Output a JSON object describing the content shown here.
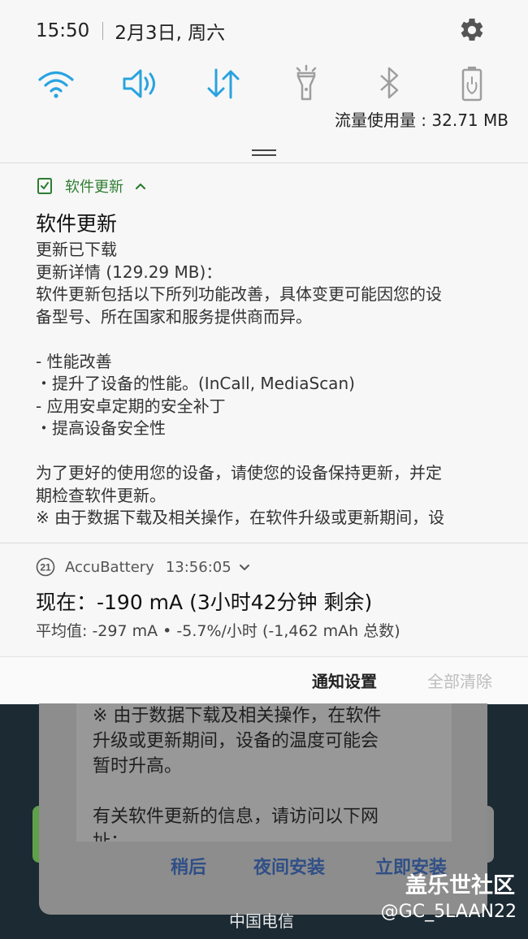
{
  "status_bar": {
    "time": "15:50",
    "date": "2月3日, 周六"
  },
  "quick_settings": {
    "icons": [
      "wifi-icon",
      "sound-icon",
      "mobile-data-icon",
      "flashlight-icon",
      "bluetooth-icon",
      "battery-saver-icon"
    ],
    "active_color": "#29a3e0",
    "inactive_color": "#9e9e9e"
  },
  "data_usage": "流量使用量 : 32.71 MB",
  "notifications": {
    "update": {
      "app_name": "软件更新",
      "title": "软件更新",
      "body": [
        "更新已下载",
        "更新详情 (129.29 MB)：",
        "软件更新包括以下所列功能改善，具体变更可能因您的设",
        "备型号、所在国家和服务提供商而异。",
        "",
        "- 性能改善",
        "・提升了设备的性能。(InCall, MediaScan)",
        "- 应用安卓定期的安全补丁",
        "・提高设备安全性",
        "",
        "为了更好的使用您的设备，请使您的设备保持更新，并定",
        "期检查软件更新。",
        "※ 由于数据下载及相关操作，在软件升级或更新期间，设"
      ]
    },
    "battery": {
      "app_badge": "21",
      "app_name": "AccuBattery",
      "time": "13:56:05",
      "title": "现在：-190 mA (3小时42分钟 剩余)",
      "subtitle": "平均值: -297 mA • -5.7%/小时 (-1,462 mAh 总数)"
    }
  },
  "footer": {
    "settings": "通知设置",
    "clear_all": "全部清除"
  },
  "background_dialog": {
    "lines": [
      "※ 由于数据下载及相关操作，在软件",
      "升级或更新期间，设备的温度可能会",
      "暂时升高。",
      "",
      "有关软件更新的信息，请访问以下网",
      "址："
    ],
    "buttons": [
      "稍后",
      "夜间安装",
      "立即安装"
    ]
  },
  "carrier": "中国电信",
  "watermark": {
    "line1": "盖乐世社区",
    "line2": "@GC_5LAAN22"
  }
}
